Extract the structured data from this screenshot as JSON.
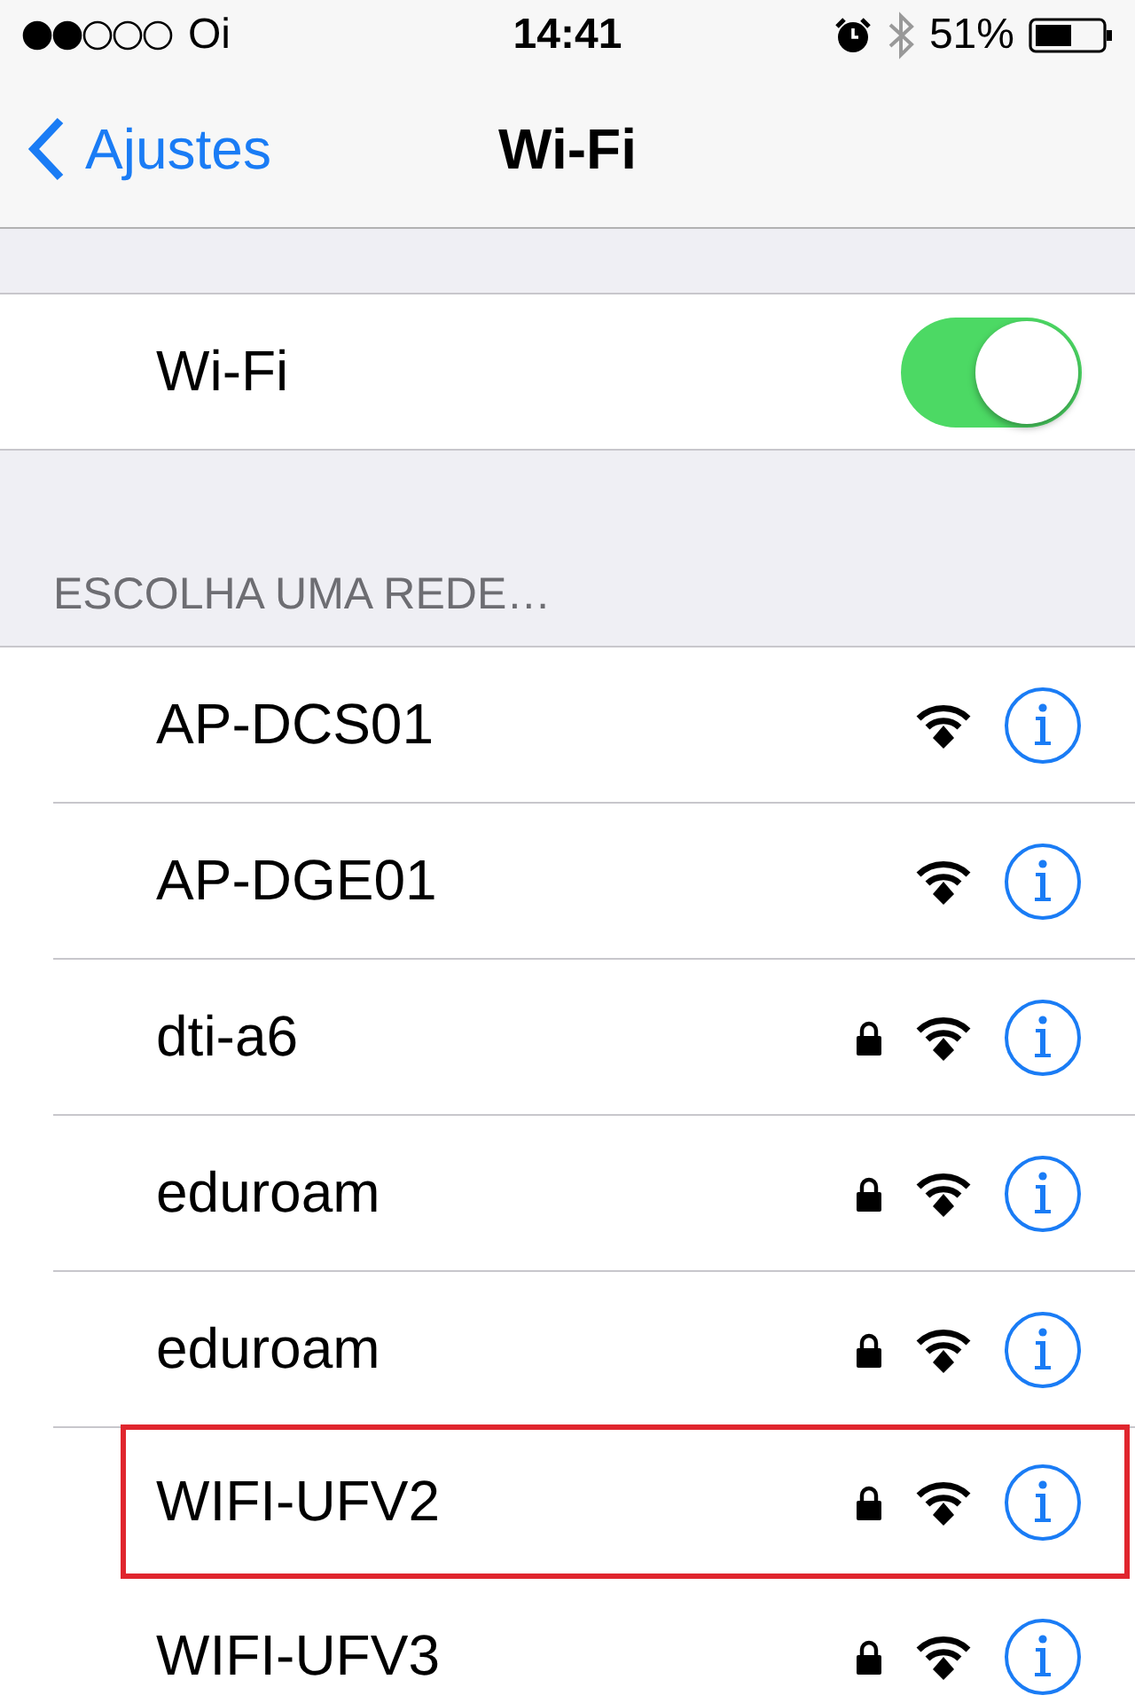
{
  "status_bar": {
    "carrier": "Oi",
    "time": "14:41",
    "battery_percent": "51%"
  },
  "nav": {
    "back": "Ajustes",
    "title": "Wi-Fi"
  },
  "wifi_toggle": {
    "label": "Wi-Fi",
    "on": true
  },
  "section_header": "ESCOLHA UMA REDE…",
  "networks": [
    {
      "name": "AP-DCS01",
      "locked": false,
      "highlighted": false
    },
    {
      "name": "AP-DGE01",
      "locked": false,
      "highlighted": false
    },
    {
      "name": "dti-a6",
      "locked": true,
      "highlighted": false
    },
    {
      "name": "eduroam",
      "locked": true,
      "highlighted": false
    },
    {
      "name": "eduroam",
      "locked": true,
      "highlighted": false
    },
    {
      "name": "WIFI-UFV2",
      "locked": true,
      "highlighted": true
    },
    {
      "name": "WIFI-UFV3",
      "locked": true,
      "highlighted": false
    }
  ]
}
